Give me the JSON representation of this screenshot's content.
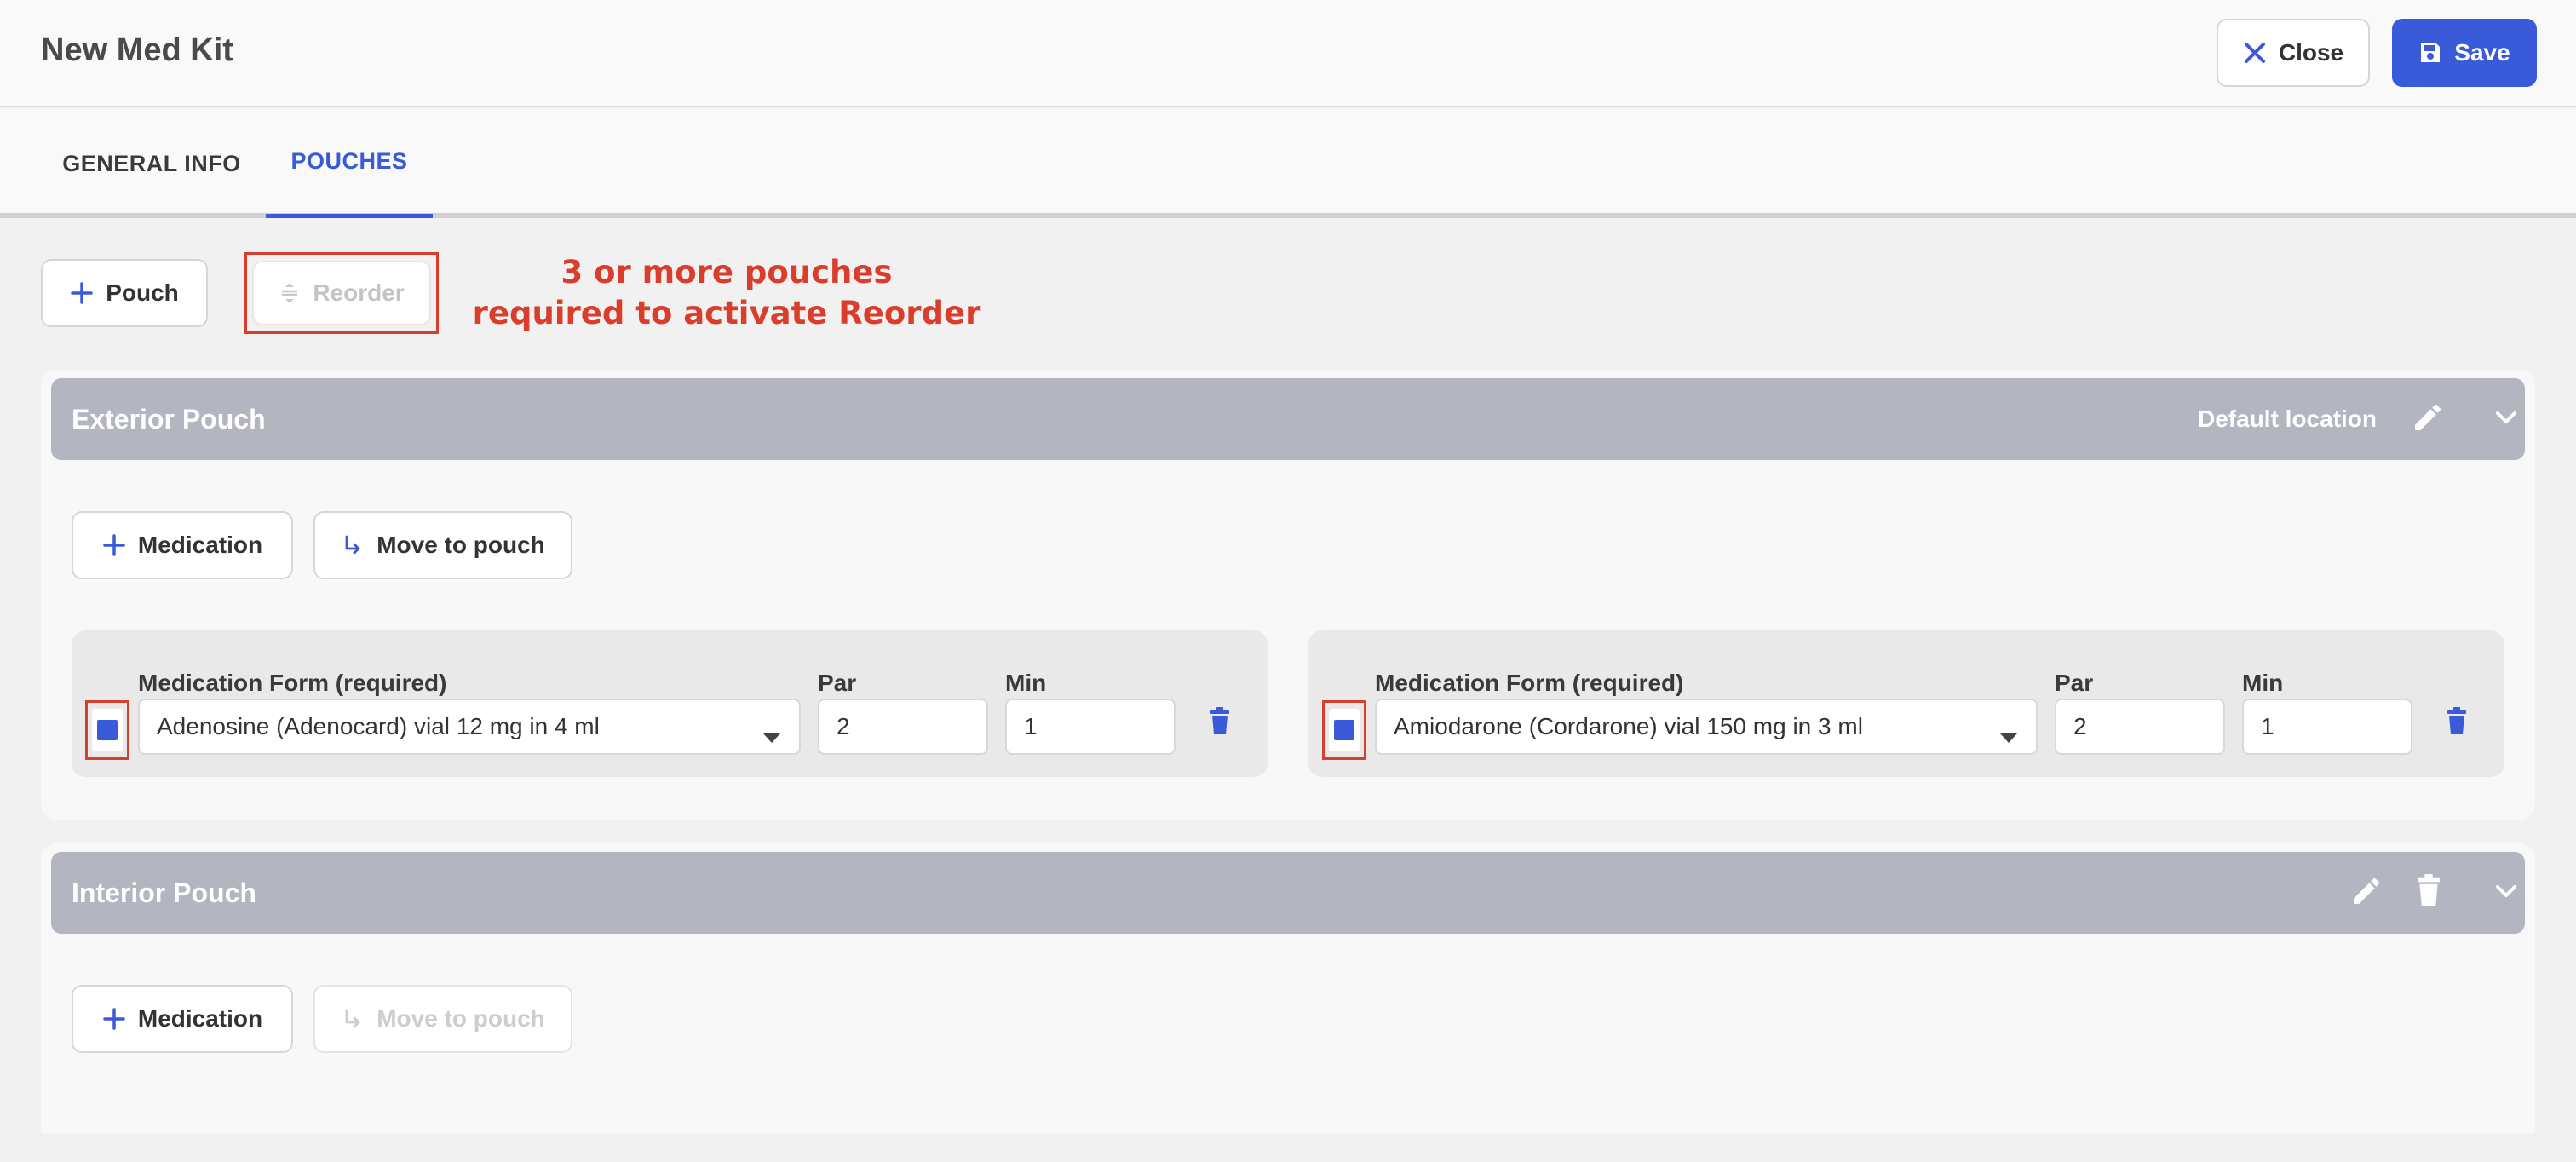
{
  "header": {
    "title": "New Med Kit",
    "close_label": "Close",
    "save_label": "Save"
  },
  "tabs": [
    {
      "label": "GENERAL INFO",
      "active": false
    },
    {
      "label": "POUCHES",
      "active": true
    }
  ],
  "toolbar": {
    "add_pouch_label": "Pouch",
    "reorder_label": "Reorder",
    "reorder_disabled": true
  },
  "annotation": {
    "line1": "3 or more pouches",
    "line2": "required to activate Reorder"
  },
  "pouches": [
    {
      "name": "Exterior Pouch",
      "location": "Default location",
      "add_medication_label": "Medication",
      "move_label": "Move to pouch",
      "medications": [
        {
          "form_label": "Medication Form (required)",
          "form_value": "Adenosine (Adenocard) vial 12 mg in 4 ml",
          "par_label": "Par",
          "par": "2",
          "min_label": "Min",
          "min": "1",
          "checked": true
        },
        {
          "form_label": "Medication Form (required)",
          "form_value": "Amiodarone (Cordarone) vial 150 mg in 3 ml",
          "par_label": "Par",
          "par": "2",
          "min_label": "Min",
          "min": "1",
          "checked": true
        }
      ]
    },
    {
      "name": "Interior Pouch",
      "add_medication_label": "Medication",
      "move_label": "Move to pouch",
      "move_disabled": true
    }
  ],
  "colors": {
    "primary": "#3a5bd9",
    "pouch_header": "#b3b5c0",
    "annotation": "#d93d2c",
    "disabled_text": "#c4c4c4"
  },
  "icons": [
    "close-icon",
    "save-icon",
    "plus-icon",
    "reorder-icon",
    "pencil-icon",
    "chevron-down-icon",
    "move-arrow-icon",
    "caret-down-icon",
    "trash-icon"
  ]
}
